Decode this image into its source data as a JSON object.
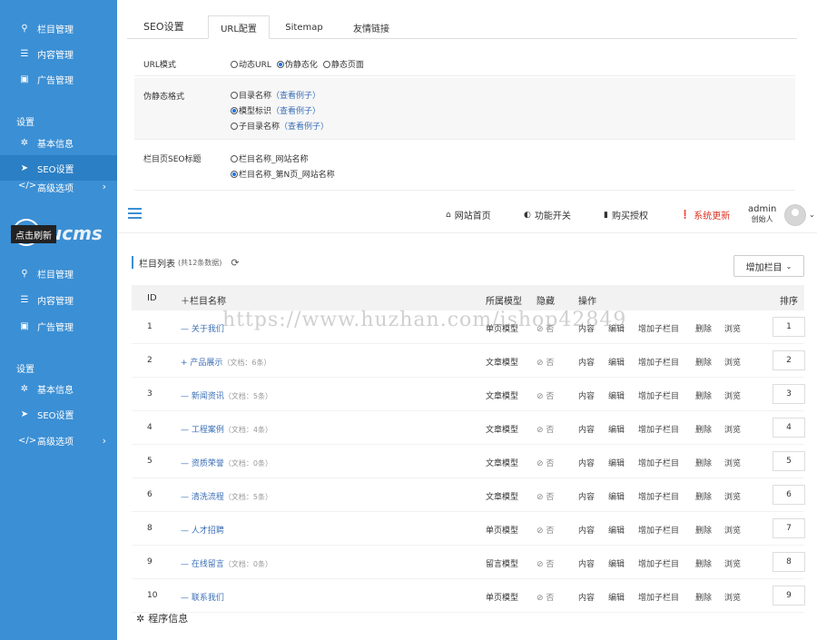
{
  "sidebar_top": {
    "items": [
      {
        "icon": "sitemap-icon",
        "label": "栏目管理"
      },
      {
        "icon": "list-icon",
        "label": "内容管理"
      },
      {
        "icon": "image-icon",
        "label": "广告管理"
      }
    ],
    "section": "设置",
    "settings": [
      {
        "icon": "gear-icon",
        "label": "基本信息"
      },
      {
        "icon": "paper-plane-icon",
        "label": "SEO设置"
      },
      {
        "icon": "code-icon",
        "label": "高级选项"
      }
    ]
  },
  "sidebar_bottom": {
    "logo_text": "ucms",
    "tooltip": "点击刷新",
    "items": [
      {
        "icon": "sitemap-icon",
        "label": "栏目管理"
      },
      {
        "icon": "list-icon",
        "label": "内容管理"
      },
      {
        "icon": "image-icon",
        "label": "广告管理"
      }
    ],
    "section": "设置",
    "settings": [
      {
        "icon": "gear-icon",
        "label": "基本信息"
      },
      {
        "icon": "paper-plane-icon",
        "label": "SEO设置"
      },
      {
        "icon": "code-icon",
        "label": "高级选项"
      }
    ]
  },
  "seo": {
    "title": "SEO设置",
    "tabs": [
      "URL配置",
      "Sitemap",
      "友情链接"
    ],
    "url_mode": {
      "label": "URL模式",
      "options": [
        "动态URL",
        "伪静态化",
        "静态页面"
      ],
      "selected": 1
    },
    "rewrite": {
      "label": "伪静态格式",
      "options": [
        {
          "text": "目录名称",
          "example": "（查看例子）"
        },
        {
          "text": "模型标识",
          "example": "（查看例子）"
        },
        {
          "text": "子目录名称",
          "example": "（查看例子）"
        }
      ],
      "selected": 1
    },
    "title_fmt": {
      "label": "栏目页SEO标题",
      "options": [
        "栏目名称_网站名称",
        "栏目名称_第N页_网站名称"
      ],
      "selected": 1
    }
  },
  "header": {
    "home": "网站首页",
    "switch": "功能开关",
    "buy": "购买授权",
    "update": "系统更新",
    "user": "admin",
    "role": "创始人"
  },
  "list": {
    "title": "栏目列表",
    "count": "(共12条数据)",
    "add_button": "增加栏目",
    "columns": {
      "id": "ID",
      "name": "栏目名称",
      "model": "所属模型",
      "hide": "隐藏",
      "ops": "操作",
      "sort": "排序"
    },
    "rows": [
      {
        "id": "1",
        "prefix": "—",
        "name": "关于我们",
        "note": "",
        "model": "单页模型",
        "hide": "否",
        "sort": "1"
      },
      {
        "id": "2",
        "prefix": "+",
        "name": "产品展示",
        "note": "（文档：6条）",
        "model": "文章模型",
        "hide": "否",
        "sort": "2"
      },
      {
        "id": "3",
        "prefix": "—",
        "name": "新闻资讯",
        "note": "（文档：5条）",
        "model": "文章模型",
        "hide": "否",
        "sort": "3"
      },
      {
        "id": "4",
        "prefix": "—",
        "name": "工程案例",
        "note": "（文档：4条）",
        "model": "文章模型",
        "hide": "否",
        "sort": "4"
      },
      {
        "id": "5",
        "prefix": "—",
        "name": "资质荣誉",
        "note": "（文档：0条）",
        "model": "文章模型",
        "hide": "否",
        "sort": "5"
      },
      {
        "id": "6",
        "prefix": "—",
        "name": "清洗流程",
        "note": "（文档：5条）",
        "model": "文章模型",
        "hide": "否",
        "sort": "6"
      },
      {
        "id": "8",
        "prefix": "—",
        "name": "人才招聘",
        "note": "",
        "model": "单页模型",
        "hide": "否",
        "sort": "7"
      },
      {
        "id": "9",
        "prefix": "—",
        "name": "在线留言",
        "note": "（文档：0条）",
        "model": "留言模型",
        "hide": "否",
        "sort": "8"
      },
      {
        "id": "10",
        "prefix": "—",
        "name": "联系我们",
        "note": "",
        "model": "单页模型",
        "hide": "否",
        "sort": "9"
      }
    ],
    "actions": [
      "内容",
      "编辑",
      "增加子栏目",
      "删除",
      "浏览"
    ]
  },
  "footer": {
    "info": "程序信息"
  },
  "watermark": "https://www.huzhan.com/ishop42849"
}
